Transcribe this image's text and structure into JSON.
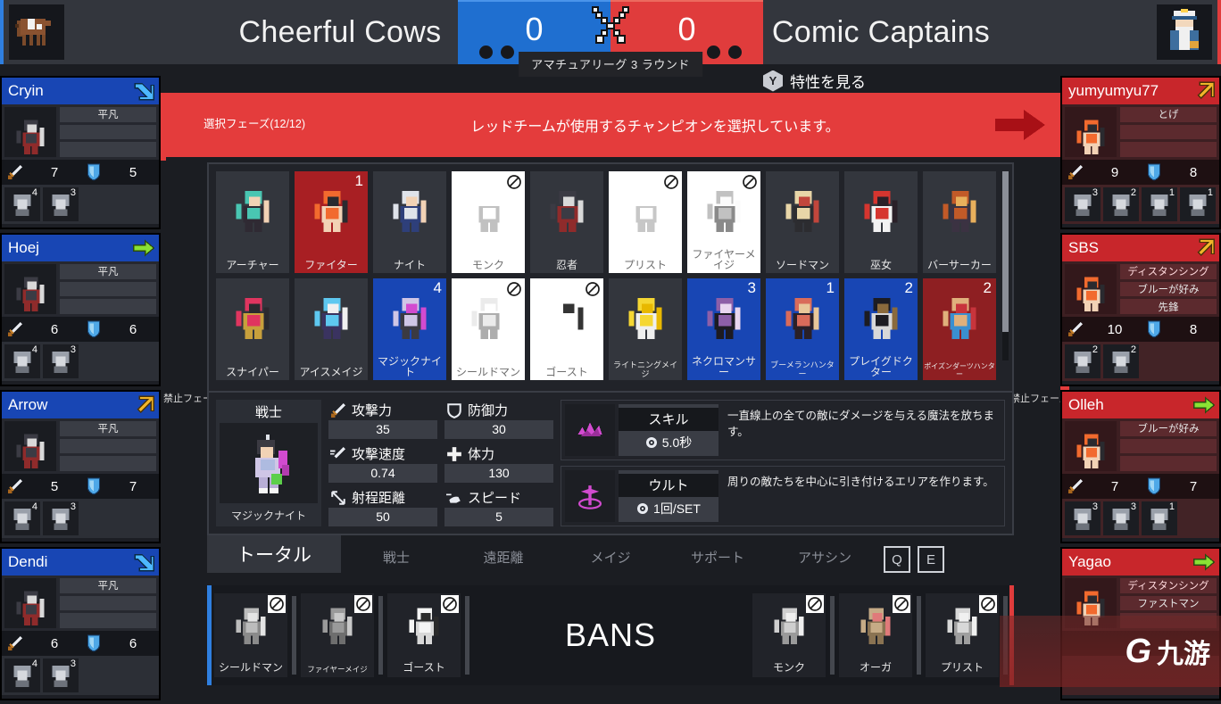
{
  "header": {
    "blue_team": {
      "name": "Cheerful Cows",
      "logo_icon": "cow-icon",
      "accent": "#2f7fe0"
    },
    "red_team": {
      "name": "Comic Captains",
      "logo_icon": "captain-icon",
      "accent": "#e03c3c"
    },
    "scoreboard": {
      "blue_score": "0",
      "red_score": "0",
      "center_icon": "crossed-swords-icon",
      "round_label": "アマチュアリーグ 3 ラウンド"
    },
    "trait_button": {
      "key": "Y",
      "label": "特性を見る"
    }
  },
  "banner": {
    "phase": "選択フェーズ(12/12)",
    "message": "レッドチームが使用するチャンピオンを選択しています。",
    "arrow_icon": "arrow-right-icon",
    "ban_phase_left": "禁止フェーズ",
    "ban_phase_right": "禁止フェーズ",
    "color": "#e43c3c"
  },
  "blue_players": [
    {
      "name": "Cryin",
      "status_icon": "arrow-down-right-icon",
      "traits": [
        "平凡",
        "",
        ""
      ],
      "attack": "7",
      "defense": "5",
      "picks": [
        {
          "icon": "monk-head-icon",
          "cost": "4"
        },
        {
          "icon": "archer-head-icon",
          "cost": "3"
        }
      ]
    },
    {
      "name": "Hoej",
      "status_icon": "arrow-right-green-icon",
      "traits": [
        "平凡",
        "",
        ""
      ],
      "attack": "6",
      "defense": "6",
      "picks": [
        {
          "icon": "priest-head-icon",
          "cost": "4"
        },
        {
          "icon": "monk-head-icon",
          "cost": "3"
        }
      ]
    },
    {
      "name": "Arrow",
      "status_icon": "arrow-up-right-icon",
      "traits": [
        "平凡",
        "",
        ""
      ],
      "attack": "5",
      "defense": "7",
      "picks": [
        {
          "icon": "magicknight-head-icon",
          "cost": "4"
        },
        {
          "icon": "fighter-head-icon",
          "cost": "3"
        }
      ]
    },
    {
      "name": "Dendi",
      "status_icon": "arrow-down-right-icon",
      "traits": [
        "平凡",
        "",
        ""
      ],
      "attack": "6",
      "defense": "6",
      "picks": [
        {
          "icon": "firemage-head-icon",
          "cost": "4"
        },
        {
          "icon": "miko-head-icon",
          "cost": "3"
        }
      ]
    }
  ],
  "red_players": [
    {
      "name": "yumyumyu77",
      "status_icon": "arrow-up-right-icon",
      "traits": [
        "とげ",
        "",
        ""
      ],
      "attack": "9",
      "defense": "8",
      "picks": [
        {
          "icon": "ghost-head-icon",
          "cost": "3"
        },
        {
          "icon": "necromancer-head-icon",
          "cost": "2"
        },
        {
          "icon": "icemage-head-icon",
          "cost": "1"
        },
        {
          "icon": "poisondart-head-icon",
          "cost": "1"
        }
      ]
    },
    {
      "name": "SBS",
      "status_icon": "arrow-up-right-icon",
      "traits": [
        "ディスタンシング",
        "ブルーが好み",
        "先鋒"
      ],
      "attack": "10",
      "defense": "8",
      "picks": [
        {
          "icon": "priest-head-icon",
          "cost": "2"
        },
        {
          "icon": "plaguedoctor-head-icon",
          "cost": "2"
        }
      ]
    },
    {
      "name": "Olleh",
      "status_icon": "arrow-right-green-icon",
      "traits": [
        "ブルーが好み",
        "",
        ""
      ],
      "attack": "7",
      "defense": "7",
      "picks": [
        {
          "icon": "fighter-head-icon",
          "cost": "3"
        },
        {
          "icon": "monk-head-icon",
          "cost": "3"
        },
        {
          "icon": "lightningmage-head-icon",
          "cost": "1"
        }
      ]
    },
    {
      "name": "Yagao",
      "status_icon": "arrow-right-green-icon",
      "traits": [
        "ディスタンシング",
        "ファストマン",
        ""
      ],
      "attack": "",
      "defense": "",
      "picks": []
    }
  ],
  "champion_grid": {
    "rows": [
      [
        {
          "name": "アーチャー",
          "icon": "archer-icon",
          "state": "normal",
          "cost": ""
        },
        {
          "name": "ファイター",
          "icon": "fighter-icon",
          "state": "cur-red",
          "cost": "1"
        },
        {
          "name": "ナイト",
          "icon": "knight-icon",
          "state": "normal",
          "cost": ""
        },
        {
          "name": "モンク",
          "icon": "monk-icon",
          "state": "banned",
          "cost": ""
        },
        {
          "name": "忍者",
          "icon": "ninja-icon",
          "state": "normal",
          "cost": ""
        },
        {
          "name": "プリスト",
          "icon": "priest-icon",
          "state": "banned",
          "cost": ""
        },
        {
          "name": "ファイヤーメイジ",
          "icon": "firemage-icon",
          "state": "banned",
          "cost": ""
        },
        {
          "name": "ソードマン",
          "icon": "swordman-icon",
          "state": "normal",
          "cost": ""
        },
        {
          "name": "巫女",
          "icon": "miko-icon",
          "state": "normal",
          "cost": ""
        },
        {
          "name": "バーサーカー",
          "icon": "berserker-icon",
          "state": "normal",
          "cost": ""
        }
      ],
      [
        {
          "name": "スナイパー",
          "icon": "sniper-icon",
          "state": "normal",
          "cost": ""
        },
        {
          "name": "アイスメイジ",
          "icon": "icemage-icon",
          "state": "normal",
          "cost": ""
        },
        {
          "name": "マジックナイト",
          "icon": "magicknight-icon",
          "state": "sel-blue",
          "cost": "4"
        },
        {
          "name": "シールドマン",
          "icon": "shieldman-icon",
          "state": "banned",
          "cost": ""
        },
        {
          "name": "ゴースト",
          "icon": "ghost-icon",
          "state": "banned",
          "cost": ""
        },
        {
          "name": "ライトニングメイジ",
          "icon": "lightningmage-icon",
          "state": "normal",
          "cost": ""
        },
        {
          "name": "ネクロマンサー",
          "icon": "necromancer-icon",
          "state": "sel-blue",
          "cost": "3"
        },
        {
          "name": "ブーメランハンター",
          "icon": "boomeranghunter-icon",
          "state": "sel-blue",
          "cost": "1"
        },
        {
          "name": "プレイグドクター",
          "icon": "plaguedoctor-icon",
          "state": "sel-blue",
          "cost": "2"
        },
        {
          "name": "ポイズンダーツハンター",
          "icon": "poisondart-icon",
          "state": "sel-red",
          "cost": "2"
        }
      ]
    ]
  },
  "unit_detail": {
    "role": "戦士",
    "name": "マジックナイト",
    "icon": "magicknight-icon",
    "stats": [
      {
        "label": "攻撃力",
        "value": "35",
        "icon": "sword-icon"
      },
      {
        "label": "攻撃速度",
        "value": "0.74",
        "icon": "attack-speed-icon"
      },
      {
        "label": "射程距離",
        "value": "50",
        "icon": "range-icon"
      },
      {
        "label": "防御力",
        "value": "30",
        "icon": "shield-icon"
      },
      {
        "label": "体力",
        "value": "130",
        "icon": "health-icon"
      },
      {
        "label": "スピード",
        "value": "5",
        "icon": "speed-icon"
      }
    ],
    "skills": [
      {
        "title": "スキル",
        "cooldown": "5.0秒",
        "icon": "magic-wave-icon",
        "desc": "一直線上の全ての敵にダメージを与える魔法を放ちます。"
      },
      {
        "title": "ウルト",
        "cooldown": "1回/SET",
        "icon": "pull-area-icon",
        "desc": "周りの敵たちを中心に引き付けるエリアを作ります。"
      }
    ]
  },
  "tabs": {
    "items": [
      {
        "label": "トータル",
        "active": true
      },
      {
        "label": "戦士",
        "active": false
      },
      {
        "label": "遠距離",
        "active": false
      },
      {
        "label": "メイジ",
        "active": false
      },
      {
        "label": "サポート",
        "active": false
      },
      {
        "label": "アサシン",
        "active": false
      }
    ],
    "icon_buttons": [
      {
        "label": "Q",
        "name": "key-q-button"
      },
      {
        "label": "E",
        "name": "key-e-button"
      }
    ]
  },
  "bans": {
    "title": "BANS",
    "blue_bans": [
      {
        "name": "シールドマン",
        "icon": "shieldman-icon"
      },
      {
        "name": "ファイヤーメイジ",
        "icon": "firemage-icon"
      },
      {
        "name": "ゴースト",
        "icon": "ghost-icon"
      }
    ],
    "red_bans": [
      {
        "name": "モンク",
        "icon": "monk-icon"
      },
      {
        "name": "オーガ",
        "icon": "ogre-icon"
      },
      {
        "name": "プリスト",
        "icon": "priest-icon"
      }
    ]
  },
  "watermark": {
    "mark": "G",
    "text": "九游"
  }
}
